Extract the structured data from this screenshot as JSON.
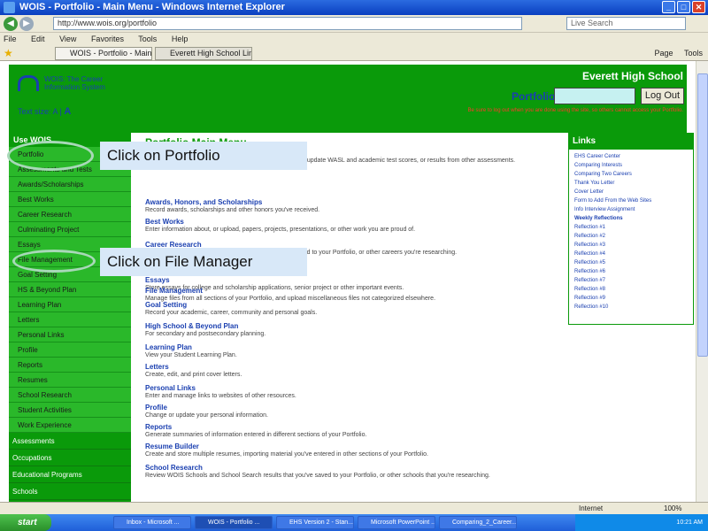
{
  "window": {
    "title": "WOIS - Portfolio - Main Menu - Windows Internet Explorer"
  },
  "address": {
    "url": "http://www.wois.org/portfolio",
    "search_placeholder": "Live Search"
  },
  "menu": [
    "File",
    "Edit",
    "View",
    "Favorites",
    "Tools",
    "Help"
  ],
  "tabs": [
    "WOIS - Portfolio - Main M...",
    "Everett High School Links"
  ],
  "toolbar_right": [
    "Page",
    "Tools"
  ],
  "header": {
    "logo_text": [
      "WOIS: The Career",
      "Information System"
    ],
    "school": "Everett High School",
    "portfolio_label": "Portfolio:",
    "logout": "Log Out",
    "text_size_label": "Text size:",
    "text_size_a_small": "A",
    "text_size_a_large": "A",
    "warning": "Be sure to log out when you are done using the site, so others cannot access your Portfolio."
  },
  "sidebar": {
    "head": "Use WOIS",
    "items": [
      "Portfolio",
      "Assessments and Tests",
      "Awards/Scholarships",
      "Best Works",
      "Career Research",
      "Culminating Project",
      "Essays",
      "File Management",
      "Goal Setting",
      "HS & Beyond Plan",
      "Learning Plan",
      "Letters",
      "Personal Links",
      "Profile",
      "Reports",
      "Resumes",
      "School Research",
      "Student Activities",
      "Work Experience"
    ],
    "sections": [
      "Assessments",
      "Occupations",
      "Educational Programs",
      "Schools"
    ]
  },
  "main": {
    "title": "Portfolio Main Menu",
    "entries": [
      {
        "t": "Assessments and Tests",
        "d": "Review your saved WOIS Assessments or enter, review or update WASL and academic test scores, or results from other assessments."
      },
      {
        "t": "Awards, Honors, and Scholarships",
        "d": "Record awards, scholarships and other honors you've received."
      },
      {
        "t": "Best Works",
        "d": "Enter information about, or upload, papers, projects, presentations, or other work you are proud of."
      },
      {
        "t": "Career Research",
        "d": "WOIS Occupations and Educational Programs you've saved to your Portfolio, or other careers you're researching."
      },
      {
        "t": "Essays",
        "d": "Store essays for college and scholarship applications, senior project or other important events."
      },
      {
        "t": "File Management",
        "d": "Manage files from all sections of your Portfolio, and upload miscellaneous files not categorized elsewhere."
      },
      {
        "t": "Goal Setting",
        "d": "Record your academic, career, community and personal goals."
      },
      {
        "t": "High School & Beyond Plan",
        "d": "For secondary and postsecondary planning."
      },
      {
        "t": "Learning Plan",
        "d": "View your Student Learning Plan."
      },
      {
        "t": "Letters",
        "d": "Create, edit, and print cover letters."
      },
      {
        "t": "Personal Links",
        "d": "Enter and manage links to websites of other resources."
      },
      {
        "t": "Profile",
        "d": "Change or update your personal information."
      },
      {
        "t": "Reports",
        "d": "Generate summaries of information entered in different sections of your Portfolio."
      },
      {
        "t": "Resume Builder",
        "d": "Create and store multiple resumes, importing material you've entered in other sections of your Portfolio."
      },
      {
        "t": "School Research",
        "d": "Review WOIS Schools and School Search results that you've saved to your Portfolio, or other schools that you're researching."
      }
    ]
  },
  "links": {
    "head": "Links",
    "items": [
      "EHS Career Center",
      "Comparing Interests",
      "Comparing Two Careers",
      "Thank You Letter",
      "Cover Letter",
      "Form to Add From the Web Sites",
      "Info Interview Assignment"
    ],
    "weekly_head": "Weekly Reflections",
    "reflections": [
      "Reflection #1",
      "Reflection #2",
      "Reflection #3",
      "Reflection #4",
      "Reflection #5",
      "Reflection #6",
      "Reflection #7",
      "Reflection #8",
      "Reflection #9",
      "Reflection #10"
    ]
  },
  "callouts": {
    "portfolio": "Click on Portfolio",
    "file_manager": "Click on File Manager"
  },
  "statusbar": {
    "zone": "Internet",
    "zoom": "100%"
  },
  "taskbar": {
    "start": "start",
    "buttons": [
      "Inbox - Microsoft ...",
      "WOIS - Portfolio ...",
      "EHS Version 2 - Stan...",
      "Microsoft PowerPoint ...",
      "Comparing_2_Career..."
    ],
    "time": "10:21 AM"
  }
}
